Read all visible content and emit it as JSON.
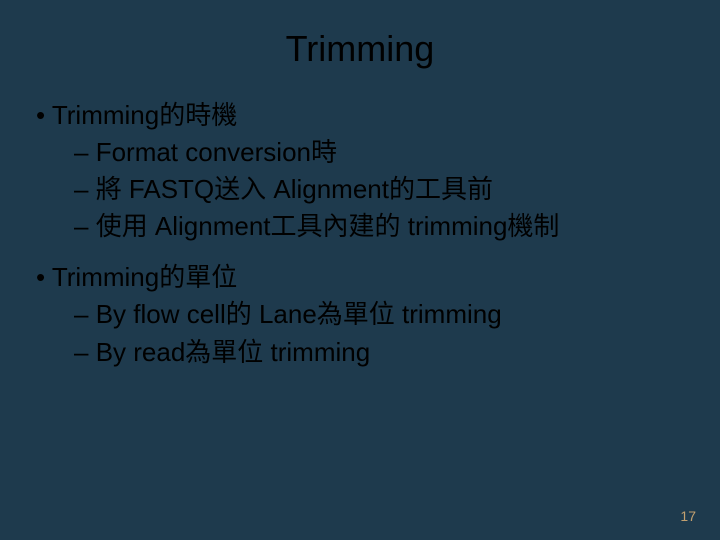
{
  "title": "Trimming",
  "section1": {
    "heading": "Trimming的時機",
    "items": [
      "Format conversion時",
      "將 FASTQ送入 Alignment的工具前",
      "使用 Alignment工具內建的 trimming機制"
    ]
  },
  "section2": {
    "heading": "Trimming的單位",
    "items": [
      "By flow cell的 Lane為單位 trimming",
      "By read為單位 trimming"
    ]
  },
  "page_number": "17"
}
